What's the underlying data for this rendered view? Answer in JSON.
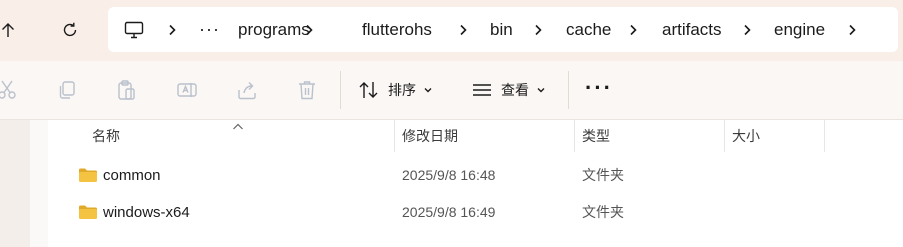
{
  "address_bar": {
    "breadcrumbs": [
      "programs",
      "flutterohs",
      "bin",
      "cache",
      "artifacts",
      "engine"
    ],
    "overflow_label": "···"
  },
  "toolbar": {
    "sort_label": "排序",
    "view_label": "查看",
    "more_label": "···"
  },
  "columns": {
    "name": "名称",
    "modified": "修改日期",
    "type": "类型",
    "size": "大小"
  },
  "files": [
    {
      "name": "common",
      "modified": "2025/9/8 16:48",
      "type": "文件夹",
      "size": ""
    },
    {
      "name": "windows-x64",
      "modified": "2025/9/8 16:49",
      "type": "文件夹",
      "size": ""
    }
  ],
  "colors": {
    "address_region_bg": "#f9efe8",
    "toolbar_bg": "#fbf7f4",
    "folder_yellow": "#f5c342",
    "disabled_icon": "#b9c1cc"
  },
  "icons": [
    "up-arrow-icon",
    "refresh-icon",
    "monitor-icon",
    "chevron-right-icon",
    "cut-icon",
    "copy-icon",
    "paste-icon",
    "rename-icon",
    "share-icon",
    "delete-icon",
    "sort-icon",
    "view-icon",
    "folder-icon"
  ]
}
